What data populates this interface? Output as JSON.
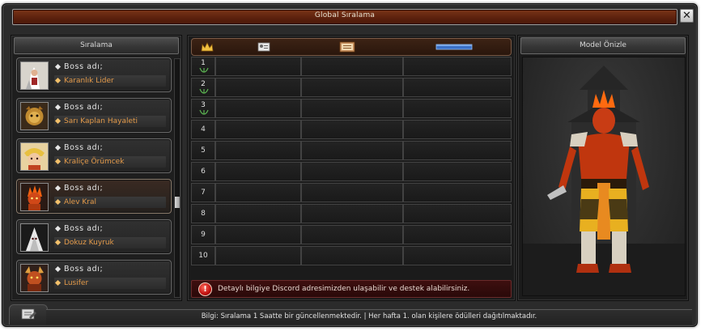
{
  "window": {
    "title": "Global Sıralama"
  },
  "left": {
    "header": "Sıralama",
    "bosses": [
      {
        "key": "Boss adı;",
        "name": "Karanlık Lider",
        "portrait": "dark-leader-portrait"
      },
      {
        "key": "Boss adı;",
        "name": "Sarı Kaplan Hayaleti",
        "portrait": "yellow-tiger-portrait"
      },
      {
        "key": "Boss adı;",
        "name": "Kraliçe Örümcek",
        "portrait": "queen-spider-portrait"
      },
      {
        "key": "Boss adı;",
        "name": "Alev Kral",
        "portrait": "flame-king-portrait"
      },
      {
        "key": "Boss adı;",
        "name": "Dokuz Kuyruk",
        "portrait": "nine-tails-portrait"
      },
      {
        "key": "Boss adı;",
        "name": "Lusifer",
        "portrait": "lucifer-portrait"
      }
    ]
  },
  "center": {
    "tabs": [
      "crown-icon",
      "id-card-icon",
      "book-icon",
      "bar-icon"
    ],
    "ranks": [
      "1",
      "2",
      "3",
      "4",
      "5",
      "6",
      "7",
      "8",
      "9",
      "10"
    ],
    "info_text": "Detaylı bilgiye Discord adresimizden ulaşabilir ve destek alabilirsiniz."
  },
  "right": {
    "header": "Model Önizle"
  },
  "footer": {
    "text": "Bilgi: Sıralama 1 Saatte bir güncellenmektedir. | Her hafta 1. olan kişilere ödülleri dağıtılmaktadır."
  },
  "colors": {
    "accent_orange": "#e39a4a",
    "title_bar": "#5a200d",
    "info_bar": "#3e0f0f"
  }
}
